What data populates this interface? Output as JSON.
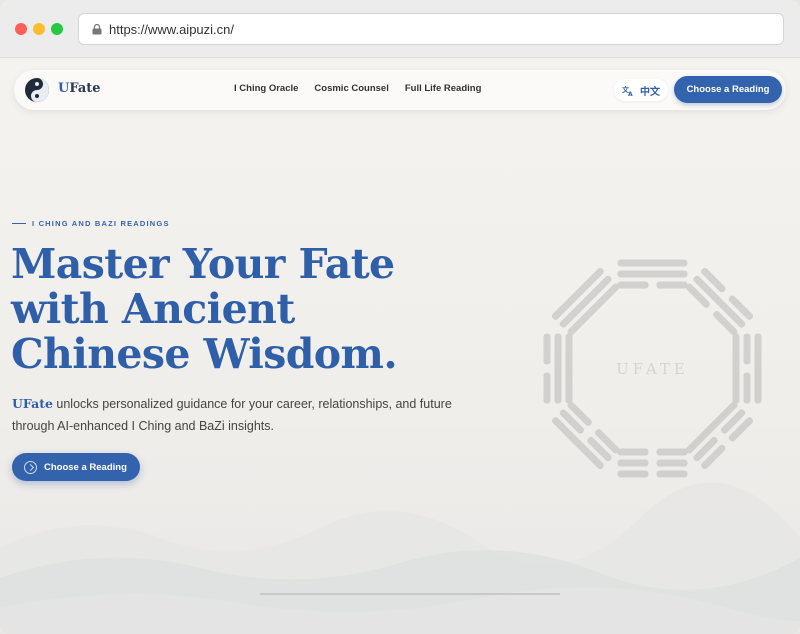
{
  "browser": {
    "url": "https://www.aipuzi.cn/"
  },
  "nav": {
    "brand_initial": "U",
    "brand_rest": "Fate",
    "links": [
      "I Ching Oracle",
      "Cosmic Counsel",
      "Full Life Reading"
    ],
    "lang_icon": "translate-icon",
    "lang_label": "中文",
    "cta_label": "Choose a Reading"
  },
  "hero": {
    "eyebrow": "I CHING AND BAZI READINGS",
    "title_lines": [
      "Master Your Fate",
      "with Ancient",
      "Chinese Wisdom."
    ],
    "subtitle_brand": "UFate",
    "subtitle_rest": " unlocks personalized guidance for your career, relationships, and future through AI-enhanced I Ching and BaZi insights.",
    "cta_label": "Choose a Reading",
    "cta_icon": "compass-icon"
  },
  "bagua": {
    "label": "UFATE"
  },
  "colors": {
    "accent": "#3463ad",
    "title": "#2f5fa8",
    "background": "#f2f0ec"
  }
}
